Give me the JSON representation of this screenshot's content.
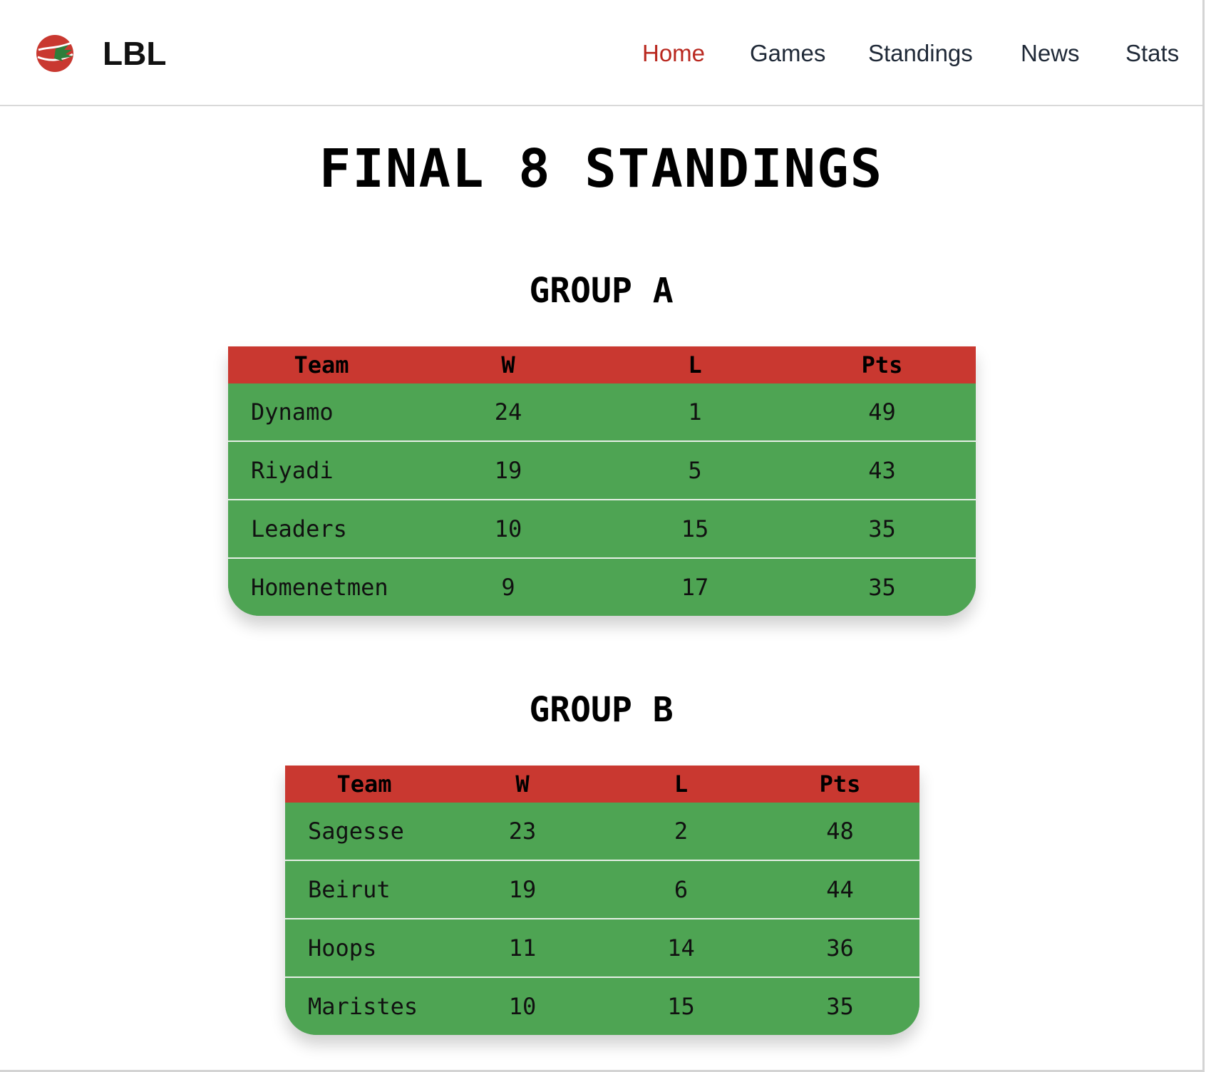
{
  "navbar": {
    "brand": "LBL",
    "logo_icon": "basketball-cedar-logo-icon",
    "items": [
      {
        "label": "Home",
        "active": true
      },
      {
        "label": "Games",
        "active": false
      },
      {
        "label": "Standings",
        "active": false
      },
      {
        "label": "News",
        "active": false
      },
      {
        "label": "Stats",
        "active": false
      }
    ]
  },
  "page": {
    "title": "FINAL 8 STANDINGS"
  },
  "groups": [
    {
      "title": "GROUP A",
      "columns": [
        "Team",
        "W",
        "L",
        "Pts"
      ],
      "rows": [
        {
          "team": "Dynamo",
          "w": "24",
          "l": "1",
          "pts": "49"
        },
        {
          "team": "Riyadi",
          "w": "19",
          "l": "5",
          "pts": "43"
        },
        {
          "team": "Leaders",
          "w": "10",
          "l": "15",
          "pts": "35"
        },
        {
          "team": "Homenetmen",
          "w": "9",
          "l": "17",
          "pts": "35"
        }
      ]
    },
    {
      "title": "GROUP B",
      "columns": [
        "Team",
        "W",
        "L",
        "Pts"
      ],
      "rows": [
        {
          "team": "Sagesse",
          "w": "23",
          "l": "2",
          "pts": "48"
        },
        {
          "team": "Beirut",
          "w": "19",
          "l": "6",
          "pts": "44"
        },
        {
          "team": "Hoops",
          "w": "11",
          "l": "14",
          "pts": "36"
        },
        {
          "team": "Maristes",
          "w": "10",
          "l": "15",
          "pts": "35"
        }
      ]
    }
  ],
  "colors": {
    "accent_red": "#c93830",
    "active_nav": "#b9281f",
    "row_green": "#4ea453",
    "logo_green": "#2e7d3a"
  }
}
